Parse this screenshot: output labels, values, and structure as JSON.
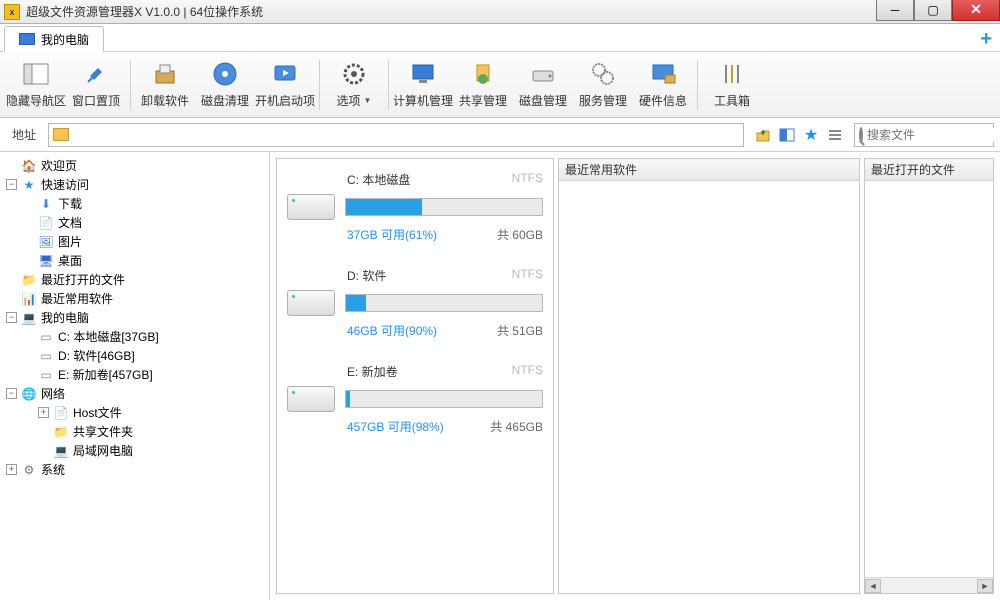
{
  "title": "超级文件资源管理器X V1.0.0  |  64位操作系统",
  "tab": {
    "label": "我的电脑"
  },
  "toolbar": [
    {
      "label": "隐藏导航区"
    },
    {
      "label": "窗口置顶"
    },
    {
      "label": "卸载软件"
    },
    {
      "label": "磁盘清理"
    },
    {
      "label": "开机启动项"
    },
    {
      "label": "选项",
      "dropdown": true
    },
    {
      "label": "计算机管理"
    },
    {
      "label": "共享管理"
    },
    {
      "label": "磁盘管理"
    },
    {
      "label": "服务管理"
    },
    {
      "label": "硬件信息"
    },
    {
      "label": "工具箱"
    }
  ],
  "addrLabel": "地址",
  "searchPlaceholder": "搜索文件",
  "tree": {
    "welcome": "欢迎页",
    "quick": "快速访问",
    "quickItems": [
      "下载",
      "文档",
      "图片",
      "桌面"
    ],
    "recent": "最近打开的文件",
    "recentSoft": "最近常用软件",
    "mypc": "我的电脑",
    "pcItems": [
      "C: 本地磁盘[37GB]",
      "D: 软件[46GB]",
      "E: 新加卷[457GB]"
    ],
    "network": "网络",
    "netItems": [
      "Host文件",
      "共享文件夹",
      "局域网电脑"
    ],
    "system": "系统"
  },
  "drives": [
    {
      "name": "C: 本地磁盘",
      "fs": "NTFS",
      "free": "37GB 可用(61%)",
      "total": "共 60GB",
      "usedPct": 39
    },
    {
      "name": "D: 软件",
      "fs": "NTFS",
      "free": "46GB 可用(90%)",
      "total": "共 51GB",
      "usedPct": 10
    },
    {
      "name": "E: 新加卷",
      "fs": "NTFS",
      "free": "457GB 可用(98%)",
      "total": "共 465GB",
      "usedPct": 2
    }
  ],
  "panels": {
    "recentSoft": "最近常用软件",
    "recentFiles": "最近打开的文件"
  }
}
